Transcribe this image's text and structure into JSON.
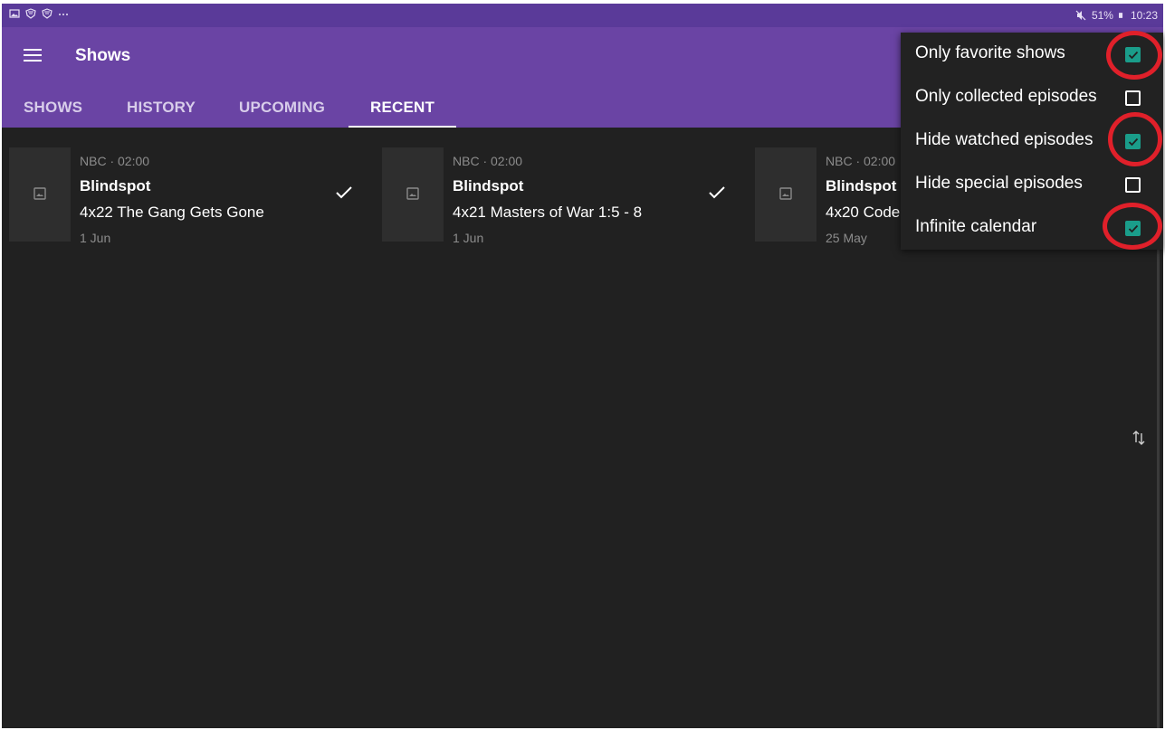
{
  "status_bar": {
    "left_icons": [
      "gallery-icon",
      "shield-icon",
      "shield-icon",
      "more-icon"
    ],
    "battery": "51%",
    "time": "10:23"
  },
  "app_bar": {
    "title": "Shows",
    "tabs": [
      {
        "label": "SHOWS",
        "active": false
      },
      {
        "label": "HISTORY",
        "active": false
      },
      {
        "label": "UPCOMING",
        "active": false
      },
      {
        "label": "RECENT",
        "active": true
      }
    ]
  },
  "episodes": [
    {
      "meta": "NBC · 02:00",
      "show": "Blindspot",
      "episode": "4x22 The Gang Gets Gone",
      "date": "1 Jun",
      "watched": true
    },
    {
      "meta": "NBC · 02:00",
      "show": "Blindspot",
      "episode": "4x21 Masters of War 1:5 - 8",
      "date": "1 Jun",
      "watched": true
    },
    {
      "meta": "NBC · 02:00",
      "show": "Blindspot",
      "episode": "4x20 Code",
      "date": "25 May",
      "watched": false
    }
  ],
  "menu": {
    "items": [
      {
        "label": "Only favorite shows",
        "checked": true
      },
      {
        "label": "Only collected episodes",
        "checked": false
      },
      {
        "label": "Hide watched episodes",
        "checked": true
      },
      {
        "label": "Hide special episodes",
        "checked": false
      },
      {
        "label": "Infinite calendar",
        "checked": true
      }
    ]
  },
  "colors": {
    "app_bar": "#6a44a4",
    "status_bar": "#5a3a99",
    "background": "#212121",
    "checkbox_accent": "#1a9d8a",
    "annotation": "#e0202a"
  }
}
